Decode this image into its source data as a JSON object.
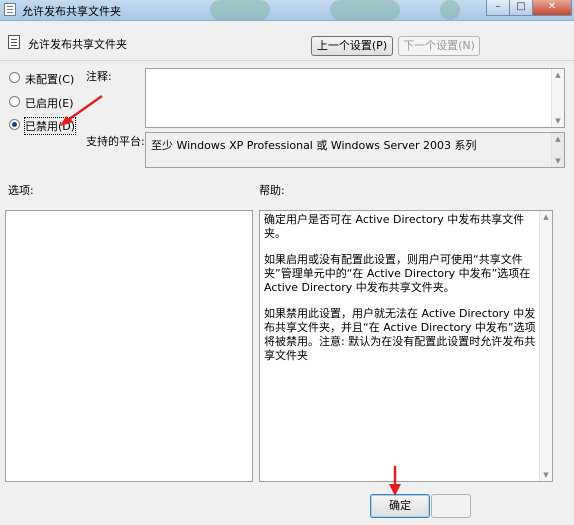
{
  "window": {
    "title": "允许发布共享文件夹",
    "minimize_label": "–",
    "maximize_label": "□",
    "close_label": "✕"
  },
  "header": {
    "title": "允许发布共享文件夹",
    "prev_button": "上一个设置(P)",
    "next_button": "下一个设置(N)"
  },
  "state": {
    "options": [
      {
        "label": "未配置(C)",
        "checked": false
      },
      {
        "label": "已启用(E)",
        "checked": false
      },
      {
        "label": "已禁用(D)",
        "checked": true
      }
    ]
  },
  "comment": {
    "label": "注释:",
    "value": ""
  },
  "platform": {
    "label": "支持的平台:",
    "value": "至少 Windows XP Professional 或 Windows Server 2003 系列"
  },
  "options_panel": {
    "label": "选项:"
  },
  "help": {
    "label": "帮助:",
    "paragraphs": [
      "确定用户是否可在 Active Directory 中发布共享文件夹。",
      "如果启用或没有配置此设置，则用户可使用“共享文件夹”管理单元中的“在 Active Directory 中发布”选项在 Active Directory 中发布共享文件夹。",
      "如果禁用此设置，用户就无法在 Active Directory 中发布共享文件夹，并且“在 Active Directory 中发布”选项将被禁用。注意: 默认为在没有配置此设置时允许发布共享文件夹"
    ]
  },
  "footer": {
    "ok_button": "确定"
  },
  "colors": {
    "annotation_arrow": "#e02020",
    "selected_radio": "#1c3f8f"
  }
}
